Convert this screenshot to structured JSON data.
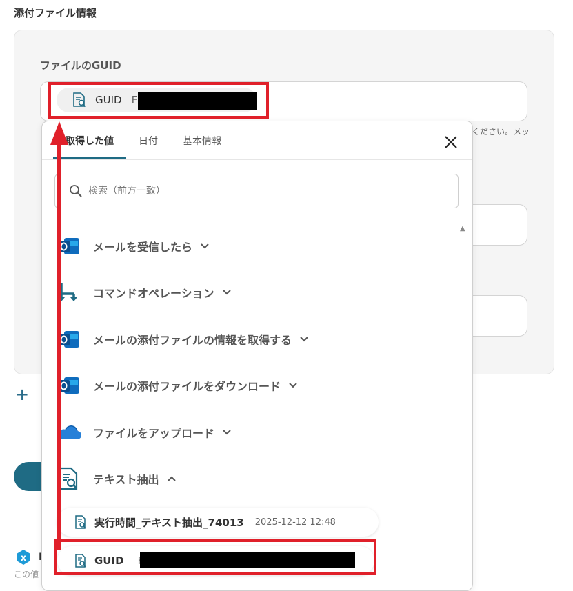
{
  "section": {
    "title": "添付ファイル情報"
  },
  "field": {
    "label": "ファイルのGUID",
    "chip": {
      "label": "GUID",
      "prefix": "F",
      "icon": "document-search-icon"
    },
    "hint": "ください。メッ"
  },
  "popup": {
    "tabs": [
      {
        "label": "取得した値",
        "active": true
      },
      {
        "label": "日付",
        "active": false
      },
      {
        "label": "基本情報",
        "active": false
      }
    ],
    "search": {
      "placeholder": "検索（前方一致）",
      "value": ""
    },
    "sections": [
      {
        "label": "メールを受信したら",
        "icon": "outlook-icon",
        "expanded": false
      },
      {
        "label": "コマンドオペレーション",
        "icon": "command-branch-icon",
        "expanded": false
      },
      {
        "label": "メールの添付ファイルの情報を取得する",
        "icon": "outlook-icon",
        "expanded": false
      },
      {
        "label": "メールの添付ファイルをダウンロード",
        "icon": "outlook-icon",
        "expanded": false
      },
      {
        "label": "ファイルをアップロード",
        "icon": "onedrive-cloud-icon",
        "expanded": false
      },
      {
        "label": "テキスト抽出",
        "icon": "document-search-icon",
        "expanded": true
      }
    ],
    "items": [
      {
        "label": "実行時間_テキスト抽出_74013",
        "time": "2025-12-12 12:48",
        "icon": "document-search-icon"
      },
      {
        "label": "GUID",
        "prefix": "F",
        "icon": "document-search-icon"
      }
    ]
  },
  "footer": {
    "plus_text": "",
    "badge_letter": "x",
    "name_initial": "I",
    "note": "この値"
  },
  "colors": {
    "accent": "#1f6b84",
    "highlight": "#e0202a",
    "outlook_blue": "#0f6cbd",
    "onedrive_blue": "#2680d8"
  }
}
